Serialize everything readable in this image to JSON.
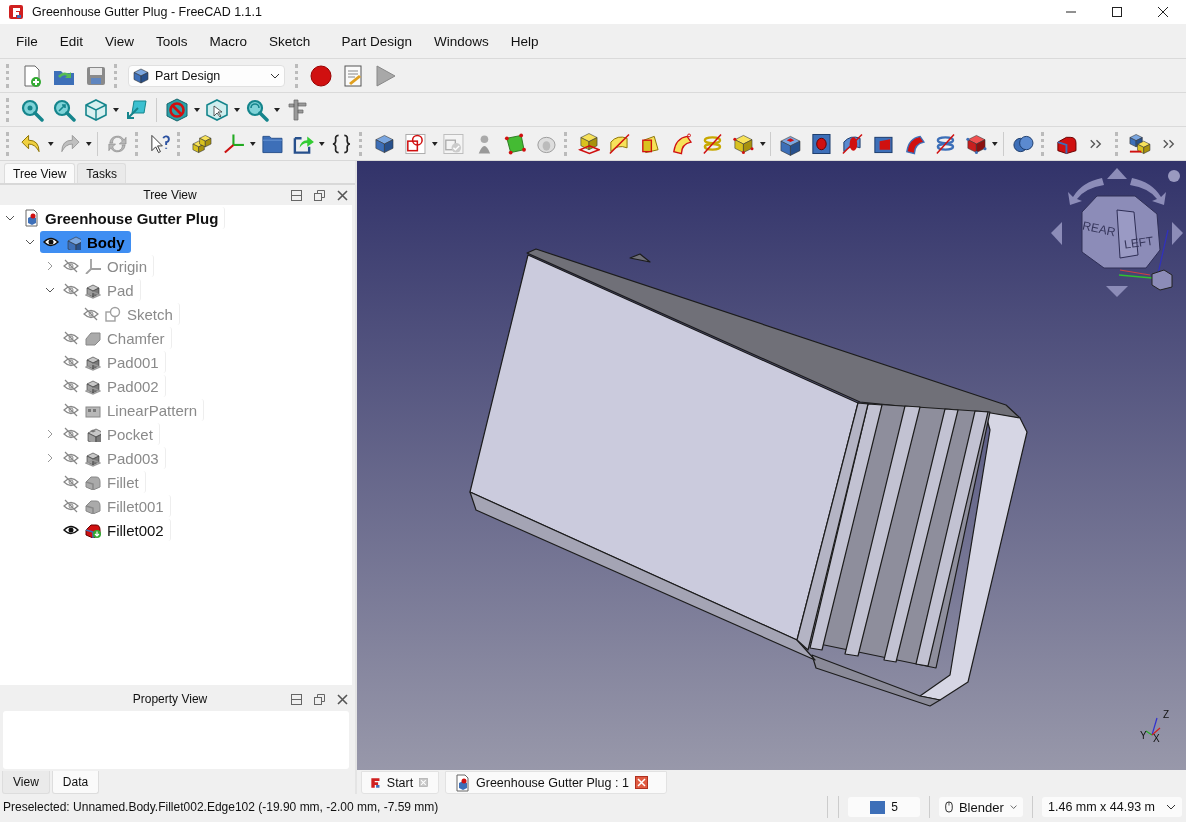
{
  "window": {
    "title": "Greenhouse Gutter Plug - FreeCAD 1.1.1"
  },
  "menu": [
    "File",
    "Edit",
    "View",
    "Tools",
    "Macro",
    "Sketch",
    "Part Design",
    "Windows",
    "Help"
  ],
  "workbench": {
    "value": "Part Design"
  },
  "left_tabs": [
    {
      "label": "Tree View",
      "selected": true
    },
    {
      "label": "Tasks",
      "selected": false
    }
  ],
  "tree_view": {
    "title": "Tree View",
    "items": [
      {
        "label": "Greenhouse Gutter Plug",
        "kind": "document",
        "selected": false,
        "expanded": true,
        "children": [
          {
            "label": "Body",
            "kind": "body",
            "active": true,
            "visible": true,
            "selected": true,
            "expanded": true,
            "children": [
              {
                "label": "Origin",
                "kind": "origin",
                "visible": false,
                "selected": false,
                "expanded": false
              },
              {
                "label": "Pad",
                "kind": "pad",
                "visible": false,
                "selected": false,
                "expanded": true,
                "children": [
                  {
                    "label": "Sketch",
                    "kind": "sketch",
                    "visible": false,
                    "selected": false
                  }
                ]
              },
              {
                "label": "Chamfer",
                "kind": "chamfer",
                "visible": false,
                "selected": false
              },
              {
                "label": "Pad001",
                "kind": "pad",
                "visible": false,
                "selected": false
              },
              {
                "label": "Pad002",
                "kind": "pad",
                "visible": false,
                "selected": false
              },
              {
                "label": "LinearPattern",
                "kind": "pattern",
                "visible": false,
                "selected": false
              },
              {
                "label": "Pocket",
                "kind": "pocket",
                "visible": false,
                "selected": false,
                "expanded": false
              },
              {
                "label": "Pad003",
                "kind": "pad",
                "visible": false,
                "selected": false,
                "expanded": false
              },
              {
                "label": "Fillet",
                "kind": "fillet",
                "visible": false,
                "selected": false
              },
              {
                "label": "Fillet001",
                "kind": "fillet",
                "visible": false,
                "selected": false
              },
              {
                "label": "Fillet002",
                "kind": "fillet",
                "visible": true,
                "selected": false
              }
            ]
          }
        ]
      }
    ]
  },
  "property_view": {
    "title": "Property View"
  },
  "property_tabs": [
    {
      "label": "View",
      "selected": false
    },
    {
      "label": "Data",
      "selected": true
    }
  ],
  "navigation_cube": {
    "faces": [
      "REAR",
      "LEFT"
    ]
  },
  "axis_labels": [
    "Z",
    "Y",
    "X"
  ],
  "document_tabs": [
    {
      "label": "Start",
      "kind": "start",
      "selected": false
    },
    {
      "label": "Greenhouse Gutter Plug : 1",
      "kind": "document",
      "selected": true
    }
  ],
  "status_bar": {
    "message": "Preselected: Unnamed.Body.Fillet002.Edge102 (-19.90 mm, -2.00 mm, -7.59 mm)",
    "draw_style": "5",
    "navigation": "Blender",
    "dimensions": "1.46 mm x 44.93 m"
  }
}
